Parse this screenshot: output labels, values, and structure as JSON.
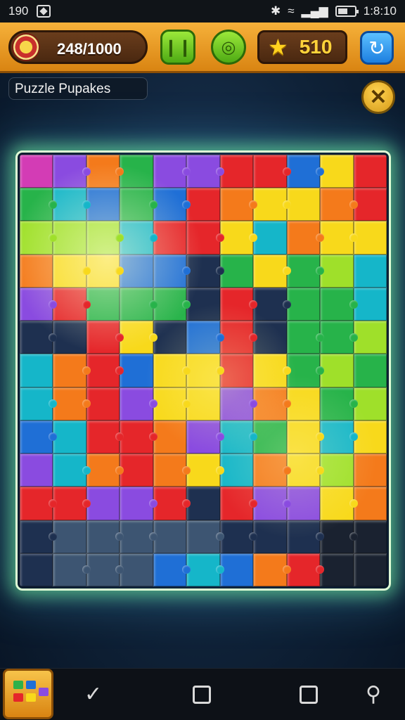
{
  "status_bar": {
    "left_text": "190",
    "time": "1:8:10",
    "icons": [
      "bluetooth-icon",
      "wifi-icon",
      "signal-icon",
      "battery-icon"
    ],
    "battery_level": 0.6
  },
  "hud": {
    "coins": "248/1000",
    "stars": "510",
    "buttons": [
      "pause-icon",
      "hint-icon",
      "refresh-icon"
    ]
  },
  "title": "Puzzle Pupakes",
  "close_symbol": "✕",
  "puzzle": {
    "columns": 11,
    "rows": 13,
    "colors": {
      "red": "#e5262a",
      "orange": "#f47a1b",
      "yellow": "#f8d91b",
      "lime": "#9fe02a",
      "green": "#27b34a",
      "teal": "#15b6c9",
      "blue": "#1f6fd6",
      "purple": "#8a4be0",
      "magenta": "#d33cb5",
      "navy": "#1e3050",
      "slate": "#3d5572",
      "dark": "#1a2230"
    },
    "grid": [
      [
        "magenta",
        "purple",
        "orange",
        "green",
        "purple",
        "purple",
        "red",
        "red",
        "blue",
        "yellow",
        "red",
        "magenta"
      ],
      [
        "green",
        "teal",
        "blue",
        "green",
        "blue",
        "red",
        "orange",
        "yellow",
        "yellow",
        "orange",
        "red",
        "yellow"
      ],
      [
        "lime",
        "lime",
        "lime",
        "teal",
        "red",
        "red",
        "yellow",
        "teal",
        "orange",
        "yellow",
        "yellow",
        "red"
      ],
      [
        "orange",
        "yellow",
        "yellow",
        "blue",
        "blue",
        "navy",
        "green",
        "yellow",
        "green",
        "lime",
        "teal",
        "teal"
      ],
      [
        "purple",
        "red",
        "green",
        "green",
        "green",
        "navy",
        "red",
        "navy",
        "green",
        "green",
        "teal",
        "teal"
      ],
      [
        "navy",
        "navy",
        "red",
        "yellow",
        "navy",
        "blue",
        "red",
        "navy",
        "green",
        "green",
        "lime",
        "teal"
      ],
      [
        "teal",
        "orange",
        "red",
        "blue",
        "yellow",
        "yellow",
        "red",
        "yellow",
        "green",
        "lime",
        "green",
        "teal"
      ],
      [
        "teal",
        "orange",
        "red",
        "purple",
        "yellow",
        "yellow",
        "purple",
        "orange",
        "yellow",
        "green",
        "lime",
        "lime"
      ],
      [
        "blue",
        "teal",
        "red",
        "red",
        "orange",
        "purple",
        "teal",
        "green",
        "yellow",
        "teal",
        "yellow",
        "yellow"
      ],
      [
        "purple",
        "teal",
        "orange",
        "red",
        "orange",
        "yellow",
        "teal",
        "orange",
        "yellow",
        "lime",
        "orange",
        "yellow"
      ],
      [
        "red",
        "red",
        "purple",
        "purple",
        "red",
        "navy",
        "red",
        "purple",
        "purple",
        "yellow",
        "orange",
        "dark"
      ],
      [
        "navy",
        "slate",
        "slate",
        "slate",
        "slate",
        "slate",
        "navy",
        "navy",
        "navy",
        "dark",
        "dark",
        "dark"
      ],
      [
        "navy",
        "slate",
        "slate",
        "slate",
        "blue",
        "teal",
        "blue",
        "orange",
        "red",
        "dark",
        "dark",
        "dark"
      ]
    ]
  },
  "bottom_nav": [
    "back-icon",
    "home-icon",
    "recents-icon",
    "assistant-icon"
  ]
}
